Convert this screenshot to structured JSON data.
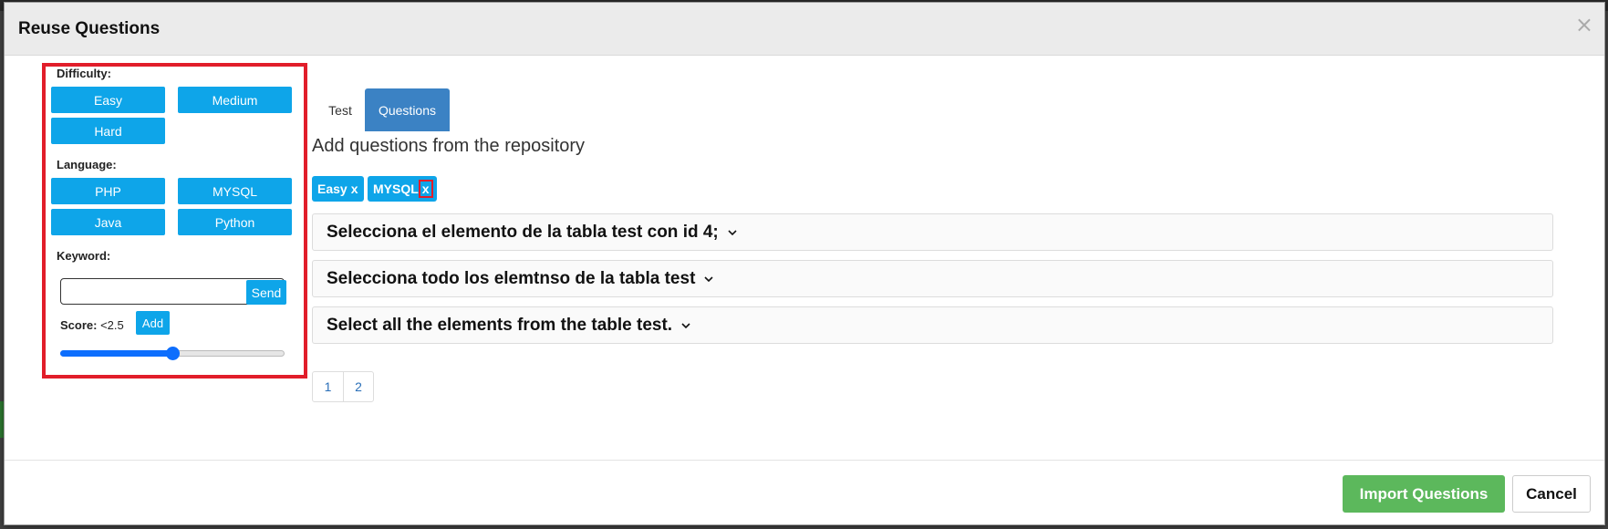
{
  "modal": {
    "title": "Reuse Questions",
    "close_label": "×"
  },
  "filters": {
    "difficulty_label": "Difficulty:",
    "difficulty_options": [
      "Easy",
      "Medium",
      "Hard"
    ],
    "language_label": "Language:",
    "language_options": [
      "PHP",
      "MYSQL",
      "Java",
      "Python"
    ],
    "keyword_label": "Keyword:",
    "keyword_value": "",
    "send_label": "Send",
    "score_label": "Score:",
    "score_value": "<2.5",
    "add_label": "Add",
    "slider_fraction": 0.5
  },
  "tabs": [
    "Test",
    "Questions"
  ],
  "active_tab": "Questions",
  "subtitle": "Add questions from the repository",
  "chips": [
    {
      "label": "Easy",
      "remove": "x"
    },
    {
      "label": "MYSQL",
      "remove": "x"
    }
  ],
  "questions": [
    "Selecciona el elemento de la tabla test con id 4;",
    "Selecciona todo los elemtnso de la tabla test",
    "Select all the elements from the table test."
  ],
  "pagination": [
    "1",
    "2"
  ],
  "footer": {
    "import_label": "Import Questions",
    "cancel_label": "Cancel"
  },
  "colors": {
    "accent": "#0ea5e9",
    "tab_active": "#3b82c4",
    "highlight": "#e11d2a",
    "import": "#5cb85c"
  }
}
